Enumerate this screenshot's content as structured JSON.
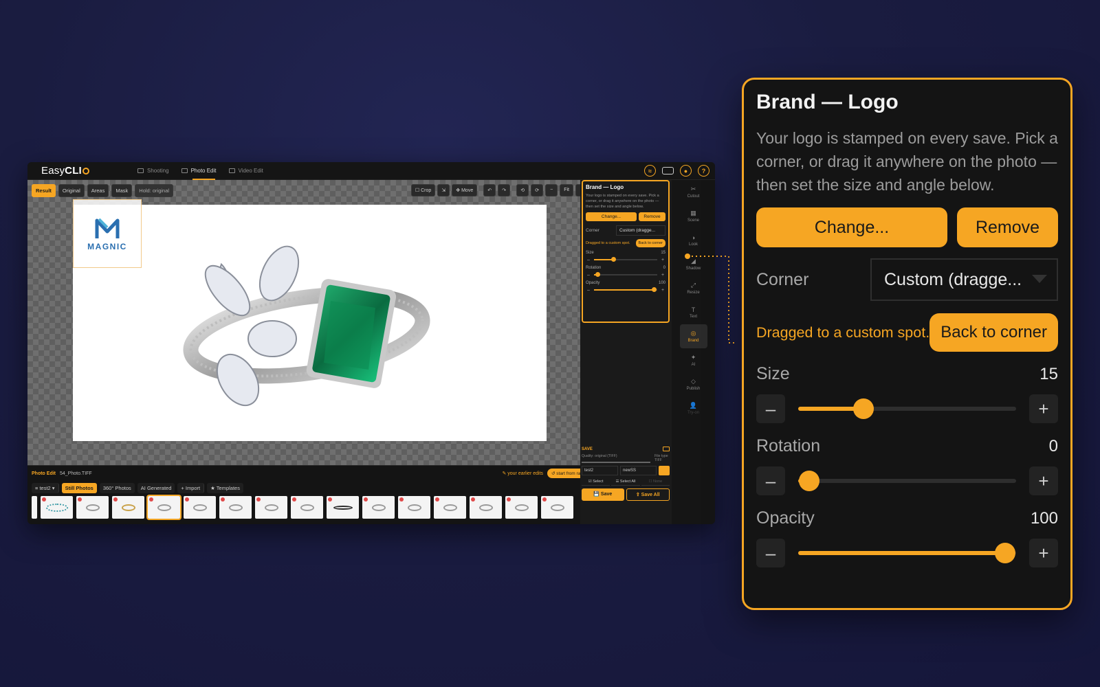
{
  "app": {
    "brand_plain": "Easy",
    "brand_bold": "CLI",
    "modes": [
      {
        "label": "Shooting",
        "active": false
      },
      {
        "label": "Photo Edit",
        "active": true
      },
      {
        "label": "Video Edit",
        "active": false
      }
    ],
    "top_icons": [
      "wifi-icon",
      "keyboard-icon",
      "user-icon",
      "help-icon"
    ]
  },
  "view_tabs": {
    "result": "Result",
    "original": "Original",
    "areas": "Areas",
    "mask": "Mask",
    "hold_hint": "Hold: original"
  },
  "tools": {
    "crop": "☐ Crop",
    "expand": "⇲",
    "move": "✥ Move",
    "undo": "↶",
    "redo": "↷",
    "rot_left": "⟲",
    "rot_right": "⟳",
    "zoom_out": "−",
    "fit": "Fit",
    "zoom_in": "+"
  },
  "canvas": {
    "logo_text": "MAGNIC"
  },
  "photo_edit_bar": {
    "title": "Photo Edit",
    "file": "54_Photo.TIFF",
    "hint": "✎ your earlier edits",
    "start_raw": "↺ start from raw"
  },
  "collections": {
    "folder": "≡ test2 ▾",
    "still": "Still Photos",
    "p360": "360° Photos",
    "ai": "AI Generated",
    "import": "+ Import",
    "templates": "★ Templates"
  },
  "thumbnails": [
    {
      "style": "first",
      "dot": false,
      "sel": false
    },
    {
      "style": "t",
      "dot": true,
      "sel": false
    },
    {
      "style": "n",
      "dot": true,
      "sel": false
    },
    {
      "style": "g",
      "dot": true,
      "sel": false
    },
    {
      "style": "n",
      "dot": true,
      "sel": true
    },
    {
      "style": "n",
      "dot": true,
      "sel": false
    },
    {
      "style": "n",
      "dot": true,
      "sel": false
    },
    {
      "style": "n",
      "dot": true,
      "sel": false
    },
    {
      "style": "n",
      "dot": true,
      "sel": false
    },
    {
      "style": "b",
      "dot": true,
      "sel": false
    },
    {
      "style": "n",
      "dot": true,
      "sel": false
    },
    {
      "style": "n",
      "dot": true,
      "sel": false
    },
    {
      "style": "n",
      "dot": true,
      "sel": false
    },
    {
      "style": "n",
      "dot": true,
      "sel": false
    },
    {
      "style": "n",
      "dot": true,
      "sel": false
    },
    {
      "style": "n",
      "dot": true,
      "sel": false
    }
  ],
  "brand_panel_small": {
    "title": "Brand — Logo",
    "desc": "Your logo is stamped on every save. Pick a corner, or drag it anywhere on the photo — then set the size and angle below.",
    "change": "Change...",
    "remove": "Remove",
    "corner_label": "Corner",
    "corner_value": "Custom (dragge...",
    "dragged": "Dragged to a custom spot.",
    "back": "Back to corner",
    "size_label": "Size",
    "size_value": "15",
    "rotation_label": "Rotation",
    "rotation_value": "0",
    "opacity_label": "Opacity",
    "opacity_value": "100",
    "minus": "–",
    "plus": "+"
  },
  "save_panel": {
    "title": "SAVE",
    "quality": "Quality: original (TIFF)",
    "file_type_label": "File type",
    "file_type": "TIFF",
    "folder": "test2",
    "name": "newSS",
    "select": "☑ Select",
    "select_all": "☰ Select All",
    "none": "☐ None",
    "save": "💾 Save",
    "save_all": "⇪ Save All"
  },
  "rail": [
    {
      "icon": "✂",
      "label": "Cutout",
      "state": "normal",
      "name": "cutout"
    },
    {
      "icon": "▦",
      "label": "Scene",
      "state": "normal",
      "name": "scene"
    },
    {
      "icon": "◑",
      "label": "Look",
      "state": "normal",
      "name": "look"
    },
    {
      "icon": "◢",
      "label": "Shadow",
      "state": "normal",
      "name": "shadow"
    },
    {
      "icon": "⤢",
      "label": "Resize",
      "state": "normal",
      "name": "resize"
    },
    {
      "icon": "T",
      "label": "Text",
      "state": "normal",
      "name": "text"
    },
    {
      "icon": "◎",
      "label": "Brand",
      "state": "on",
      "name": "brand"
    },
    {
      "icon": "✦",
      "label": "AI",
      "state": "normal",
      "name": "ai"
    },
    {
      "icon": "◇",
      "label": "Publish",
      "state": "normal",
      "name": "publish"
    },
    {
      "icon": "👤",
      "label": "Try-on",
      "state": "dim",
      "name": "try-on"
    }
  ],
  "brand_panel_zoom": {
    "title": "Brand — Logo",
    "desc": "Your logo is stamped on every save. Pick a corner, or drag it anywhere on the photo — then set the size and angle below.",
    "change": "Change...",
    "remove": "Remove",
    "corner_label": "Corner",
    "corner_value": "Custom (dragge...",
    "dragged": "Dragged to a custom spot.",
    "back": "Back to corner",
    "size_label": "Size",
    "size_value": "15",
    "rotation_label": "Rotation",
    "rotation_value": "0",
    "opacity_label": "Opacity",
    "opacity_value": "100",
    "minus": "–",
    "plus": "+"
  },
  "sliders": {
    "size_fraction": 0.3,
    "rotation_fraction": 0.05,
    "opacity_fraction": 0.95
  },
  "colors": {
    "accent": "#f6a623",
    "background": "#1a1c40",
    "panel": "#141414"
  }
}
